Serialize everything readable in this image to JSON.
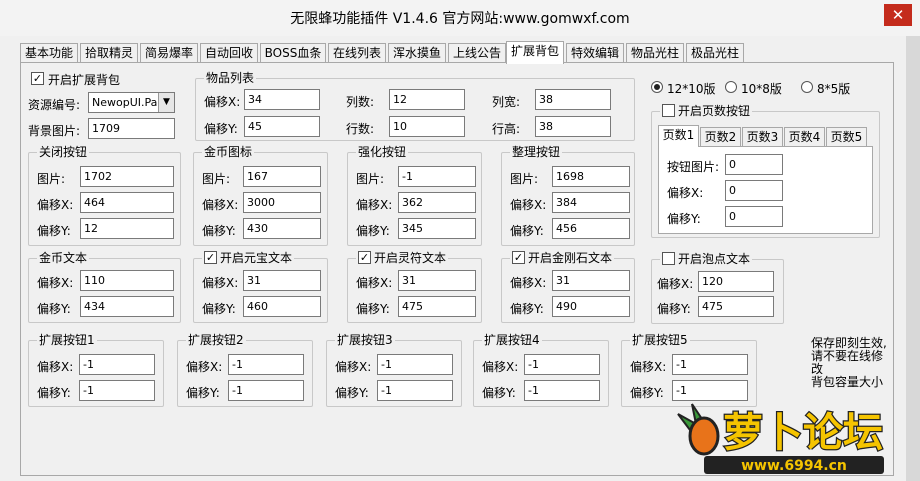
{
  "window": {
    "title": "无限蜂功能插件 V1.4.6  官方网站:www.gomwxf.com",
    "close": "✕"
  },
  "tabs": [
    "基本功能",
    "拾取精灵",
    "简易爆率",
    "自动回收",
    "BOSS血条",
    "在线列表",
    "浑水摸鱼",
    "上线公告",
    "扩展背包",
    "特效编辑",
    "物品光柱",
    "极品光柱"
  ],
  "active_tab": "扩展背包",
  "main": {
    "enable_label": "开启扩展背包",
    "enable_checked": "✓",
    "resource_label": "资源编号:",
    "resource_value": "NewopUI.Pak",
    "bg_label": "背景图片:",
    "bg_value": "1709"
  },
  "item_list": {
    "title": "物品列表",
    "offset_x_label": "偏移X:",
    "offset_x": "34",
    "offset_y_label": "偏移Y:",
    "offset_y": "45",
    "cols_label": "列数:",
    "cols": "12",
    "rows_label": "行数:",
    "rows": "10",
    "col_width_label": "列宽:",
    "col_width": "38",
    "row_height_label": "行高:",
    "row_height": "38"
  },
  "buttons": {
    "close": {
      "title": "关闭按钮",
      "pic_label": "图片:",
      "pic": "1702",
      "x_label": "偏移X:",
      "x": "464",
      "y_label": "偏移Y:",
      "y": "12"
    },
    "gold": {
      "title": "金币图标",
      "pic_label": "图片:",
      "pic": "167",
      "x_label": "偏移X:",
      "x": "3000",
      "y_label": "偏移Y:",
      "y": "430"
    },
    "enhance": {
      "title": "强化按钮",
      "pic_label": "图片:",
      "pic": "-1",
      "x_label": "偏移X:",
      "x": "362",
      "y_label": "偏移Y:",
      "y": "345"
    },
    "sort": {
      "title": "整理按钮",
      "pic_label": "图片:",
      "pic": "1698",
      "x_label": "偏移X:",
      "x": "384",
      "y_label": "偏移Y:",
      "y": "456"
    }
  },
  "texts": {
    "gold_text": {
      "title": "金币文本",
      "x_label": "偏移X:",
      "x": "110",
      "y_label": "偏移Y:",
      "y": "434"
    },
    "yuanbao": {
      "title": "开启元宝文本",
      "check": "✓",
      "x_label": "偏移X:",
      "x": "31",
      "y_label": "偏移Y:",
      "y": "460"
    },
    "lingfu": {
      "title": "开启灵符文本",
      "check": "✓",
      "x_label": "偏移X:",
      "x": "31",
      "y_label": "偏移Y:",
      "y": "475"
    },
    "diamond": {
      "title": "开启金刚石文本",
      "check": "✓",
      "x_label": "偏移X:",
      "x": "31",
      "y_label": "偏移Y:",
      "y": "490"
    }
  },
  "ext_buttons": [
    {
      "title": "扩展按钮1",
      "x_label": "偏移X:",
      "x": "-1",
      "y_label": "偏移Y:",
      "y": "-1"
    },
    {
      "title": "扩展按钮2",
      "x_label": "偏移X:",
      "x": "-1",
      "y_label": "偏移Y:",
      "y": "-1"
    },
    {
      "title": "扩展按钮3",
      "x_label": "偏移X:",
      "x": "-1",
      "y_label": "偏移Y:",
      "y": "-1"
    },
    {
      "title": "扩展按钮4",
      "x_label": "偏移X:",
      "x": "-1",
      "y_label": "偏移Y:",
      "y": "-1"
    },
    {
      "title": "扩展按钮5",
      "x_label": "偏移X:",
      "x": "-1",
      "y_label": "偏移Y:",
      "y": "-1"
    }
  ],
  "layout_options": {
    "opt1": "12*10版",
    "opt2": "10*8版",
    "opt3": "8*5版"
  },
  "page_buttons": {
    "title": "开启页数按钮",
    "tabs": [
      "页数1",
      "页数2",
      "页数3",
      "页数4",
      "页数5"
    ],
    "pic_label": "按钮图片:",
    "pic": "0",
    "x_label": "偏移X:",
    "x": "0",
    "y_label": "偏移Y:",
    "y": "0"
  },
  "bubble_text": {
    "title": "开启泡点文本",
    "x_label": "偏移X:",
    "x": "120",
    "y_label": "偏移Y:",
    "y": "475"
  },
  "note": {
    "line1": "保存即刻生效,",
    "line2": "请不要在线修改",
    "line3": "背包容量大小"
  },
  "watermark": {
    "brand": "萝卜论坛",
    "url": "www.6994.cn",
    "colors": {
      "text": "#f5c400",
      "outline": "#222222"
    }
  }
}
